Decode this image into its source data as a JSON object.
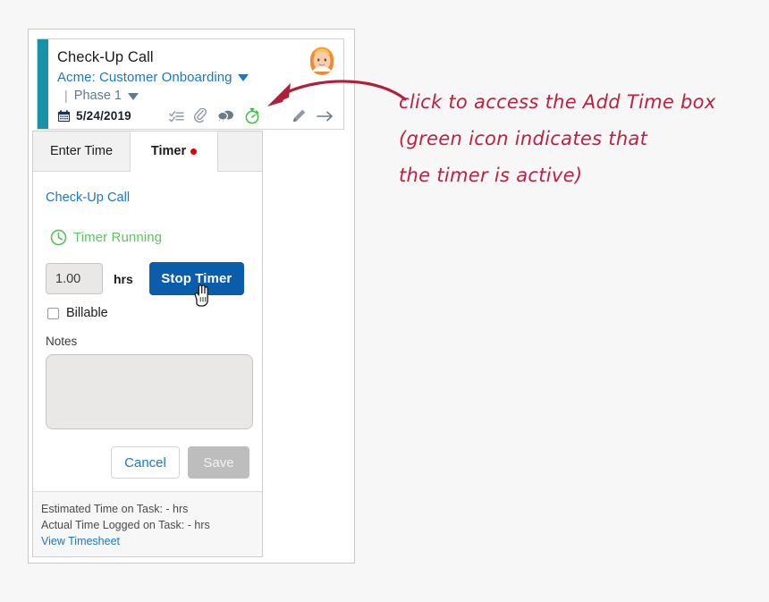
{
  "task_card": {
    "title": "Check-Up Call",
    "project": "Acme: Customer Onboarding",
    "phase_separator": "|",
    "phase": "Phase 1",
    "date": "5/24/2019",
    "icons": [
      {
        "name": "checklist-icon",
        "color": "#8a9aa5"
      },
      {
        "name": "paperclip-icon",
        "color": "#8a9aa5"
      },
      {
        "name": "comments-icon",
        "color": "#6b7c87"
      },
      {
        "name": "stopwatch-timer-icon",
        "color": "#3fbf3f"
      },
      {
        "name": "pencil-edit-icon",
        "color": "#8a9aa5"
      },
      {
        "name": "arrow-right-icon",
        "color": "#6b7c87"
      }
    ],
    "accent_bar_color": "#1792a9",
    "avatar_name": "user-avatar"
  },
  "popup": {
    "tabs": [
      {
        "label": "Enter Time",
        "active": false,
        "badge": false
      },
      {
        "label": "Timer",
        "active": true,
        "badge": true
      }
    ],
    "badge_color": "#e00000",
    "task_link": "Check-Up Call",
    "timer_status": "Timer Running",
    "timer_status_color": "#5ec45e",
    "hours_value": "1.00",
    "hours_placeholder": "0.00",
    "hours_unit": "hrs",
    "stop_timer_label": "Stop Timer",
    "stop_timer_color": "#0b5cab",
    "billable_label": "Billable",
    "billable_checked": false,
    "notes_label": "Notes",
    "notes_value": "",
    "notes_placeholder": "",
    "cancel_label": "Cancel",
    "save_label": "Save",
    "footer": {
      "estimated": "Estimated Time on Task: - hrs",
      "actual": "Actual Time Logged on Task: - hrs",
      "link": "View Timesheet"
    }
  },
  "annotation": {
    "color": "#c02040",
    "line1": "click to access the Add Time box",
    "line2": "(green icon indicates that",
    "line3": "the timer is active)"
  }
}
